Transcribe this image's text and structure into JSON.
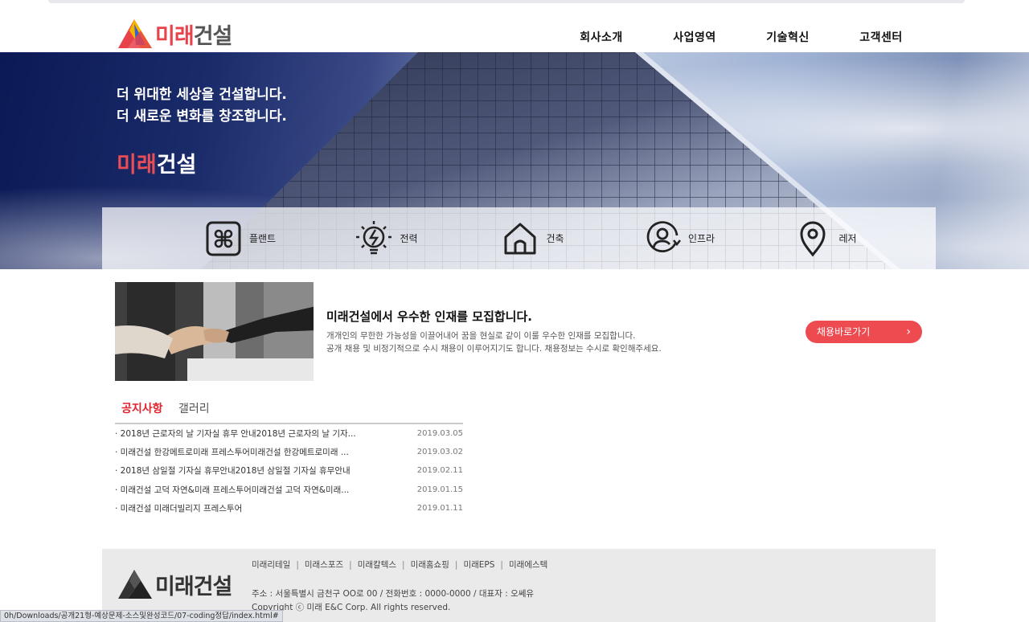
{
  "header": {
    "logo_red": "미래",
    "logo_rest": "건설",
    "nav": [
      "회사소개",
      "사업영역",
      "기술혁신",
      "고객센터"
    ]
  },
  "hero": {
    "line1": "더 위대한 세상을 건설합니다.",
    "line2": "더 새로운 변화를 창조합니다.",
    "brand_red": "미래",
    "brand_white": "건설"
  },
  "business": [
    {
      "icon": "command-icon",
      "label": "플랜트"
    },
    {
      "icon": "lightbulb-icon",
      "label": "전력"
    },
    {
      "icon": "home-icon",
      "label": "건축"
    },
    {
      "icon": "user-circle-icon",
      "label": "인프라"
    },
    {
      "icon": "location-pin-icon",
      "label": "레저"
    }
  ],
  "recruit": {
    "title": "미래건설에서 우수한 인재를 모집합니다.",
    "desc1": "개개인의 무한한 가능성을 이끌어내어 꿈을 현실로 같이 이룰 우수한 인재를 모집합니다.",
    "desc2": "공개 채용 및 비정기적으로 수시 채용이 이루어지기도 합니다. 채용정보는 수시로 확인해주세요.",
    "button": "채용바로가기",
    "button_arrow": "›"
  },
  "board": {
    "tab_notice": "공지사항",
    "tab_gallery": "갤러리",
    "notices": [
      {
        "title": "· 2018년 근로자의 날 기자실 휴무 안내2018년 근로자의 날 기자...",
        "date": "2019.03.05"
      },
      {
        "title": "· 미래건설 한강메트로미래 프레스투어미래건설 한강메트로미래 ...",
        "date": "2019.03.02"
      },
      {
        "title": "· 2018년 삼일절 기자실 휴무안내2018년 삼일절 기자실 휴무안내",
        "date": "2019.02.11"
      },
      {
        "title": "· 미래건설 고덕 자연&미래 프레스투어미래건설 고덕 자연&미래...",
        "date": "2019.01.15"
      },
      {
        "title": "· 미래건설 미래더빌리지 프레스투어",
        "date": "2019.01.11"
      }
    ]
  },
  "footer": {
    "logo": "미래건설",
    "links": [
      "미래리테일",
      "미래스포즈",
      "미래칼텍스",
      "미래홈쇼핑",
      "미래EPS",
      "미래에스텍"
    ],
    "address": "주소 : 서울특별시 금천구 OO로 00 / 전화번호 : 0000-0000 / 대표자 : 오쎄유",
    "copyright": "Copyright ⓒ 미래 E&C Corp. All rights reserved."
  },
  "statusbar": "0h/Downloads/공개21형-예상문제-소스및완성코드/07-coding정답/index.html#",
  "colors": {
    "accent": "#ee4b51",
    "brand_red": "#e8424b"
  }
}
